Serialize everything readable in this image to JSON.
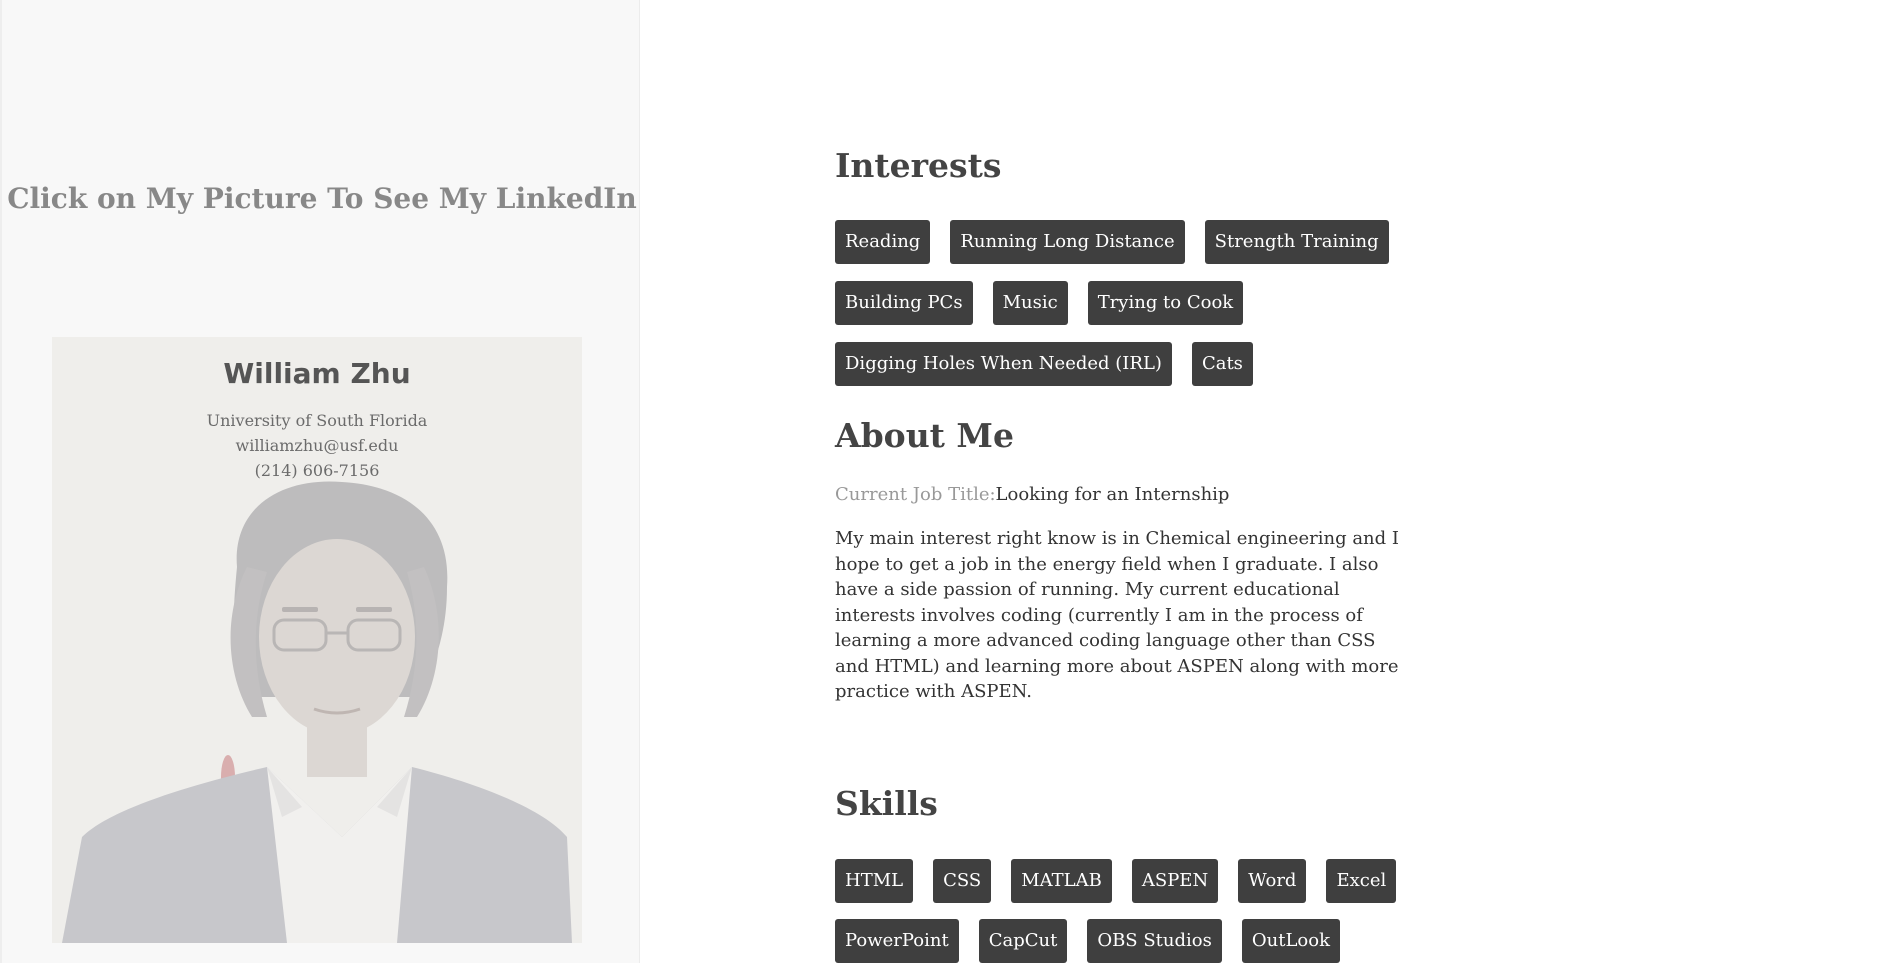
{
  "sidebar": {
    "heading": "Click on My Picture To See My LinkedIn",
    "profile": {
      "name": "William Zhu",
      "school": "University of South Florida",
      "email": "williamzhu@usf.edu",
      "phone": "(214) 606-7156",
      "photo_icon": "person-photo"
    }
  },
  "interests": {
    "title": "Interests",
    "rows": [
      [
        "Reading",
        "Running Long Distance",
        "Strength Training"
      ],
      [
        "Building PCs",
        "Music",
        "Trying to Cook"
      ],
      [
        "Digging Holes When Needed (IRL)",
        "Cats"
      ]
    ]
  },
  "about": {
    "title": "About Me",
    "job_label": "Current Job Title:",
    "job_value": "Looking for an Internship",
    "text": "My main interest right know is in Chemical engineering and I hope to get a job in the energy field when I graduate. I also have a side passion of running. My current educational interests involves coding (currently I am in the process of learning a more advanced coding language other than CSS and HTML) and learning more about ASPEN along with more practice with ASPEN."
  },
  "skills": {
    "title": "Skills",
    "rows": [
      [
        "HTML",
        "CSS",
        "MATLAB",
        "ASPEN",
        "Word",
        "Excel"
      ],
      [
        "PowerPoint",
        "CapCut",
        "OBS Studios",
        "OutLook"
      ]
    ]
  },
  "colors": {
    "sidebar_bg": "#f8f8f8",
    "tag_bg": "#3f3f3f",
    "tag_text": "#ffffff",
    "heading": "#444444",
    "muted": "#999999"
  }
}
